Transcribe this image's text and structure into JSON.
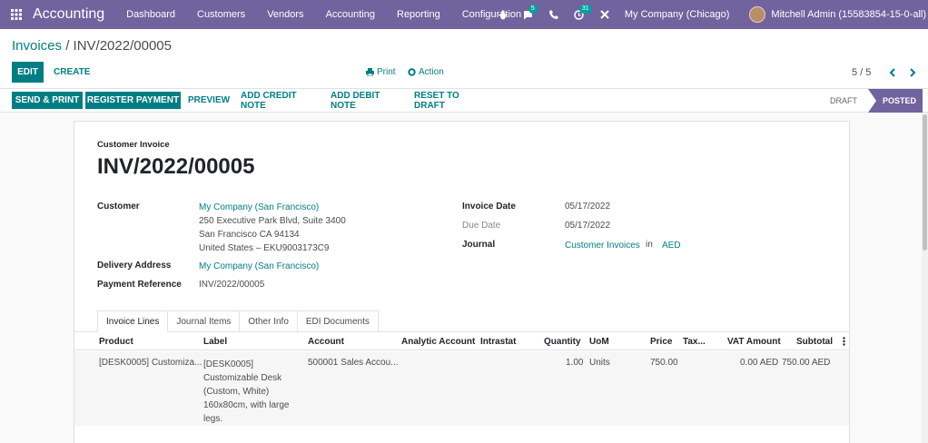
{
  "navbar": {
    "brand": "Accounting",
    "menu": [
      "Dashboard",
      "Customers",
      "Vendors",
      "Accounting",
      "Reporting",
      "Configuration"
    ],
    "messages_count": "5",
    "activities_count": "31",
    "company": "My Company (Chicago)",
    "user": "Mitchell Admin (15583854-15-0-all)"
  },
  "control": {
    "breadcrumb_parent": "Invoices",
    "breadcrumb_sep": "/",
    "breadcrumb_current": "INV/2022/00005",
    "edit_label": "EDIT",
    "create_label": "CREATE",
    "print_label": "Print",
    "action_label": "Action",
    "pager": "5 / 5"
  },
  "statusbar": {
    "send_print": "SEND & PRINT",
    "register_payment": "REGISTER PAYMENT",
    "preview": "PREVIEW",
    "add_credit_note": "ADD CREDIT NOTE",
    "add_debit_note": "ADD DEBIT NOTE",
    "reset_to_draft": "RESET TO DRAFT",
    "stage_draft": "DRAFT",
    "stage_posted": "POSTED"
  },
  "invoice": {
    "type_label": "Customer Invoice",
    "number": "INV/2022/00005",
    "customer_label": "Customer",
    "customer_name": "My Company (San Francisco)",
    "address_line1": "250 Executive Park Blvd, Suite 3400",
    "address_line2": "San Francisco CA 94134",
    "address_line3": "United States – EKU9003173C9",
    "delivery_label": "Delivery Address",
    "delivery_value": "My Company (San Francisco)",
    "payment_ref_label": "Payment Reference",
    "payment_ref_value": "INV/2022/00005",
    "invoice_date_label": "Invoice Date",
    "invoice_date": "05/17/2022",
    "due_date_label": "Due Date",
    "due_date": "05/17/2022",
    "journal_label": "Journal",
    "journal_value": "Customer Invoices",
    "journal_in": "in",
    "currency": "AED"
  },
  "tabs": [
    "Invoice Lines",
    "Journal Items",
    "Other Info",
    "EDI Documents"
  ],
  "table": {
    "columns": [
      "Product",
      "Label",
      "Account",
      "Analytic Account",
      "Intrastat",
      "Quantity",
      "UoM",
      "Price",
      "Tax...",
      "VAT Amount",
      "Subtotal"
    ],
    "row": {
      "product": "[DESK0005] Customiza...",
      "label": "[DESK0005] Customizable Desk (Custom, White) 160x80cm, with large legs.",
      "account": "500001 Sales Accou...",
      "quantity": "1.00",
      "uom": "Units",
      "price": "750.00",
      "vat_amount": "0.00 AED",
      "subtotal": "750.00 AED"
    }
  }
}
